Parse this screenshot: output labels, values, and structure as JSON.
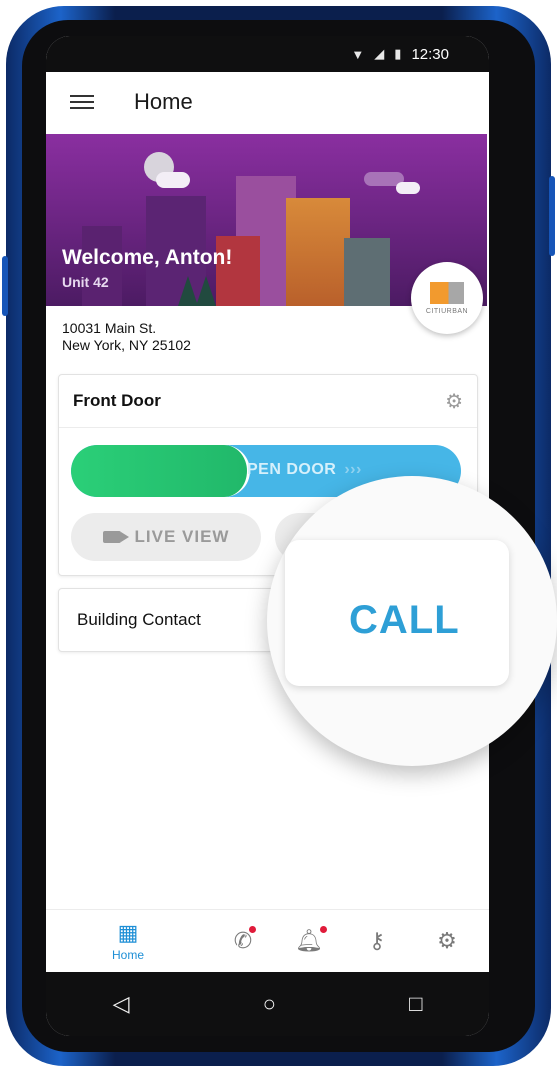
{
  "status": {
    "time": "12:30",
    "icons": [
      "wifi-icon",
      "signal-icon",
      "battery-icon"
    ]
  },
  "appbar": {
    "title": "Home",
    "menu_icon": "menu-icon"
  },
  "banner": {
    "welcome": "Welcome, Anton!",
    "unit": "Unit 42",
    "logo_text": "CITIURBAN"
  },
  "address": {
    "line1": "10031 Main St.",
    "line2": "New York, NY 25102"
  },
  "door": {
    "title": "Front Door",
    "slider_label": "PEN DOOR",
    "slider_chevrons": "›››",
    "slider_progress": 0.45,
    "live_view_label": "LIVE VIEW",
    "settings_icon": "gear-icon"
  },
  "contact": {
    "title": "Building Contact",
    "call_label": "CALL"
  },
  "nav": {
    "home_label": "Home",
    "items": [
      "building-icon",
      "phone-icon",
      "bell-icon",
      "key-icon",
      "user-settings-icon"
    ]
  },
  "system_nav": {
    "back": "◁",
    "home": "○",
    "recents": "□"
  },
  "colors": {
    "accent": "#1e8fd6",
    "slider_blue": "#46b6e7",
    "slider_green": "#21b86a",
    "banner_purple": "#7b2a92",
    "notification": "#e01b3a"
  }
}
